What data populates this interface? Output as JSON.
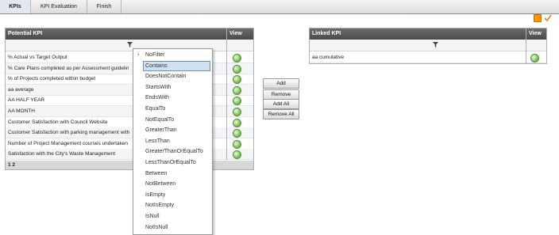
{
  "tabs": [
    {
      "label": "KPIs",
      "active": true
    },
    {
      "label": "KPI Evaluation",
      "active": false
    },
    {
      "label": "Finish",
      "active": false
    }
  ],
  "toolbar": {
    "icons": [
      "save-icon",
      "check-edit-icon"
    ]
  },
  "left_grid": {
    "col_name": "Potential KPI",
    "col_view": "View",
    "rows": [
      "% Actual vs Target Output",
      "% Care Plans completed as per Assessment guidelin",
      "% of Projects completed within budget",
      "aa average",
      "AA HALF YEAR",
      "AA MONTH",
      "Customer Satisfaction with Council Website",
      "Customer Satisfaction with parking management with",
      "Number of Project Management courses undertaken",
      "Satisfaction with the City's Waste Management"
    ],
    "footer": "1 2"
  },
  "right_grid": {
    "col_name": "Linked KPI",
    "col_view": "View",
    "rows": [
      "aa cumulative"
    ]
  },
  "buttons": {
    "add": "Add",
    "remove": "Remove",
    "add_all": "Add All",
    "remove_all": "Remove All"
  },
  "filter_menu": {
    "items": [
      "NoFilter",
      "Contains",
      "DoesNotContain",
      "StartsWith",
      "EndsWith",
      "EqualTo",
      "NotEqualTo",
      "GreaterThan",
      "LessThan",
      "GreaterThanOrEqualTo",
      "LessThanOrEqualTo",
      "Between",
      "NotBetween",
      "IsEmpty",
      "NotIsEmpty",
      "IsNull",
      "NotIsNull"
    ],
    "selected": "Contains",
    "current": "NoFilter"
  },
  "colors": {
    "header": "#555555",
    "selected": "#cfe0f3",
    "save": "#ff9800"
  }
}
